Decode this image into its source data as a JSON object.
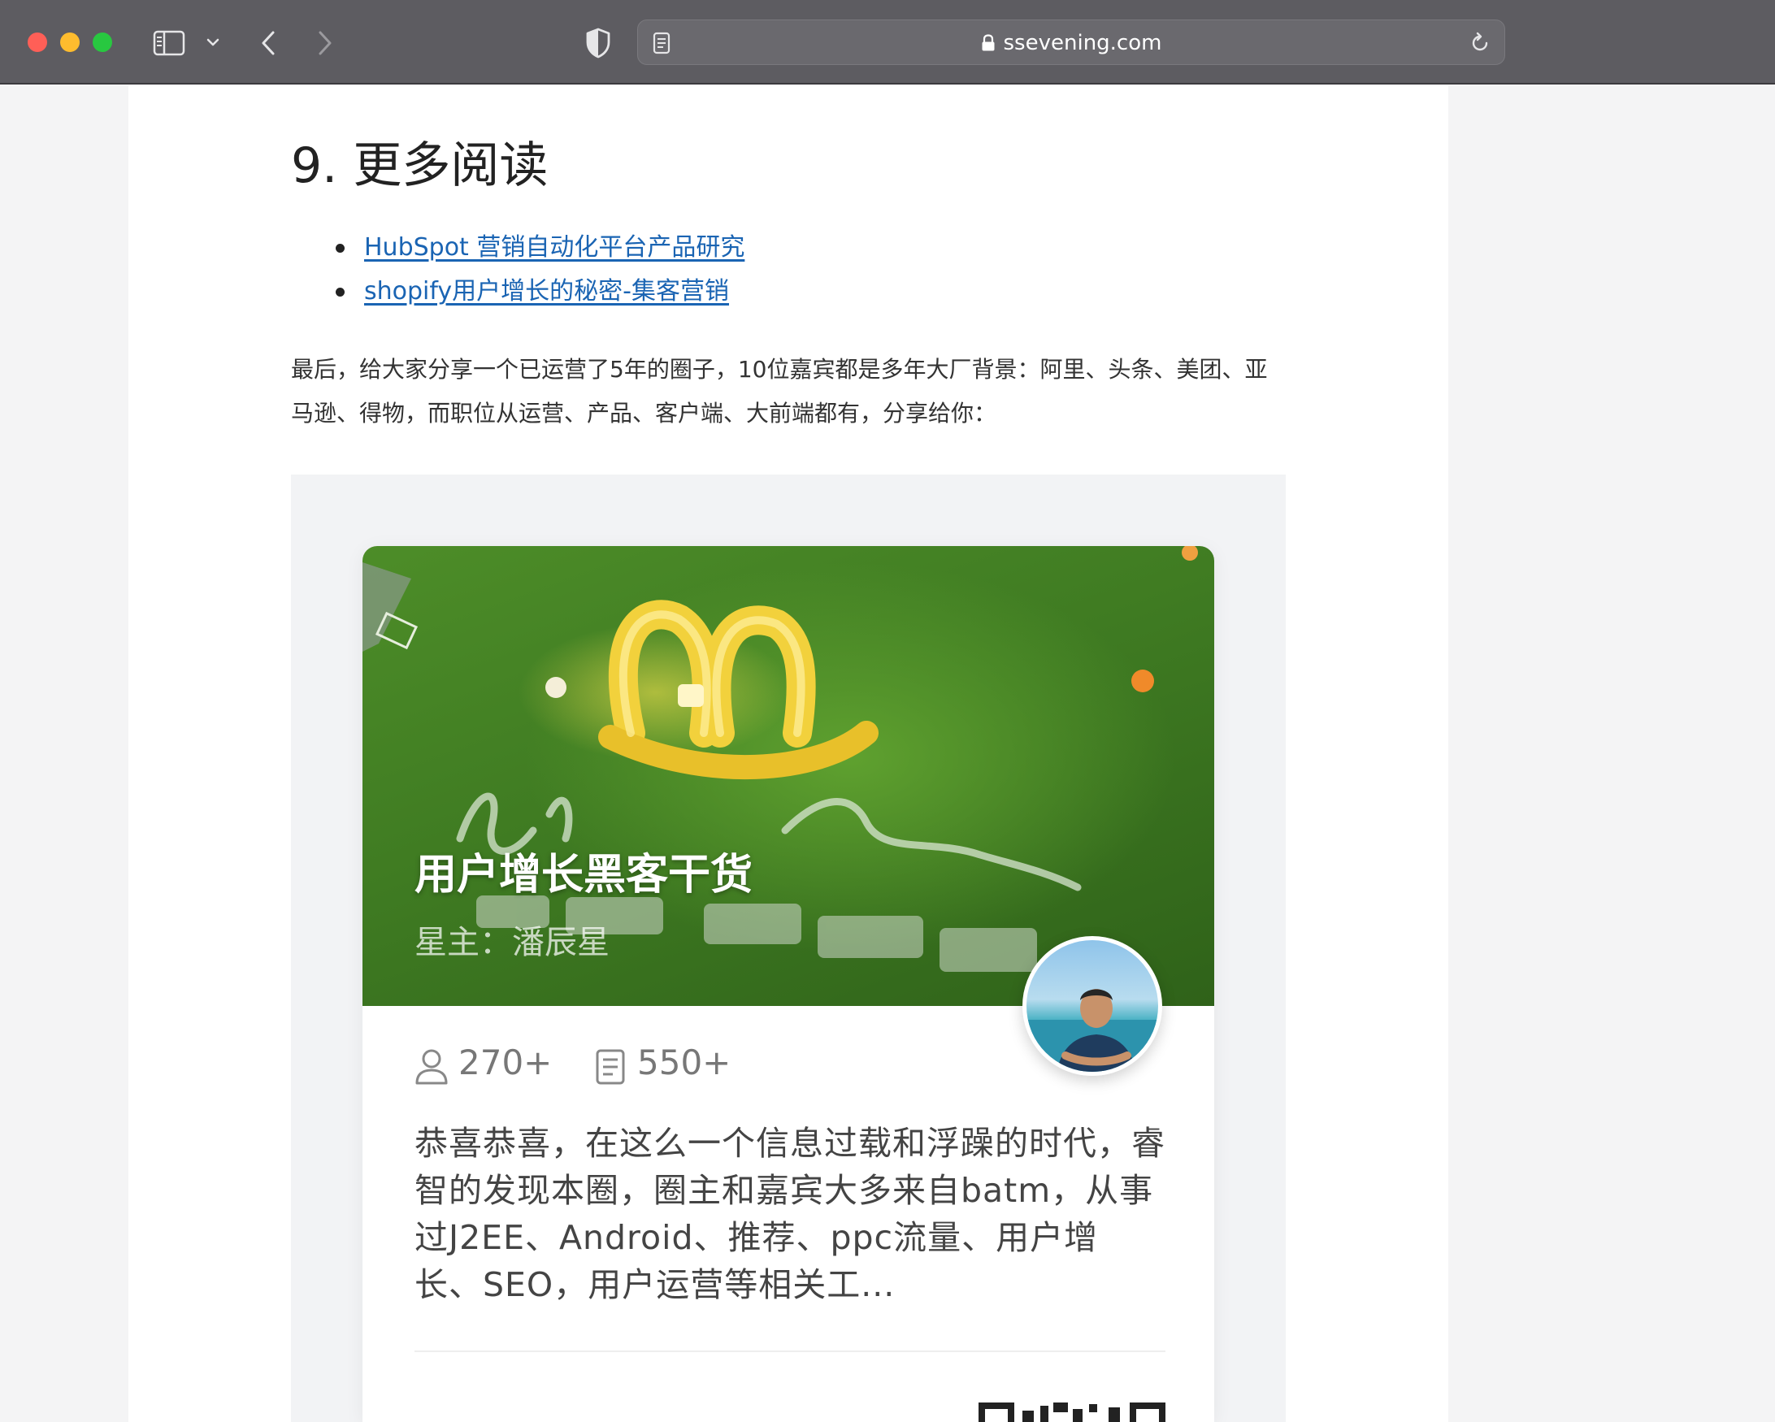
{
  "browser": {
    "url": "ssevening.com"
  },
  "article": {
    "heading": "9. 更多阅读",
    "links": [
      {
        "label": "HubSpot 营销自动化平台产品研究"
      },
      {
        "label": "shopify用户增长的秘密-集客营销"
      }
    ],
    "paragraph": "最后，给大家分享一个已运营了5年的圈子，10位嘉宾都是多年大厂背景：阿里、头条、美团、亚马逊、得物，而职位从运营、产品、客户端、大前端都有，分享给你："
  },
  "card": {
    "title": "用户增长黑客干货",
    "owner": "星主：潘辰星",
    "members": "270+",
    "posts": "550+",
    "description": "恭喜恭喜，在这么一个信息过载和浮躁的时代，睿智的发现本圈，圈主和嘉宾大多来自batm，从事过J2EE、Android、推荐、ppc流量、用户增长、SEO，用户运营等相关工..."
  },
  "icons": {
    "sidebar": "sidebar-icon",
    "chevron": "chevron-down-icon",
    "back": "chevron-left-icon",
    "forward": "chevron-right-icon",
    "privacy": "shield-icon",
    "reader": "reader-icon",
    "lock": "lock-icon",
    "reload": "reload-icon",
    "members": "user-icon",
    "posts": "document-icon"
  },
  "colors": {
    "link": "#1a64b3",
    "titlebar": "#5d5c61",
    "traffic_red": "#ff5f57",
    "traffic_yellow": "#febc2e",
    "traffic_green": "#28c840"
  }
}
